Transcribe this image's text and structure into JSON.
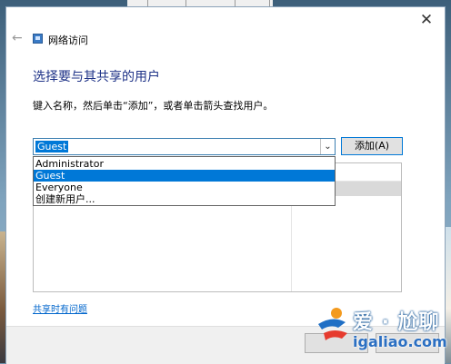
{
  "window": {
    "title": "网络访问",
    "close_glyph": "✕",
    "back_glyph": "←"
  },
  "main": {
    "heading": "选择要与其共享的用户",
    "instruction": "键入名称，然后单击“添加”，或者单击箭头查找用户。"
  },
  "combo": {
    "value": "Guest",
    "arrow_glyph": "⌄"
  },
  "add_button": {
    "label": "添加(A)"
  },
  "dropdown": {
    "items": [
      "Administrator",
      "Guest",
      "Everyone",
      "创建新用户..."
    ],
    "selected_index": 1
  },
  "help_link": {
    "label": "共享时有问题"
  },
  "watermark": {
    "brand_cn": "爱 · 尬聊",
    "url": "igaliao.com"
  },
  "colors": {
    "accent": "#0078d7",
    "heading": "#1e3287",
    "link": "#0066cc"
  }
}
